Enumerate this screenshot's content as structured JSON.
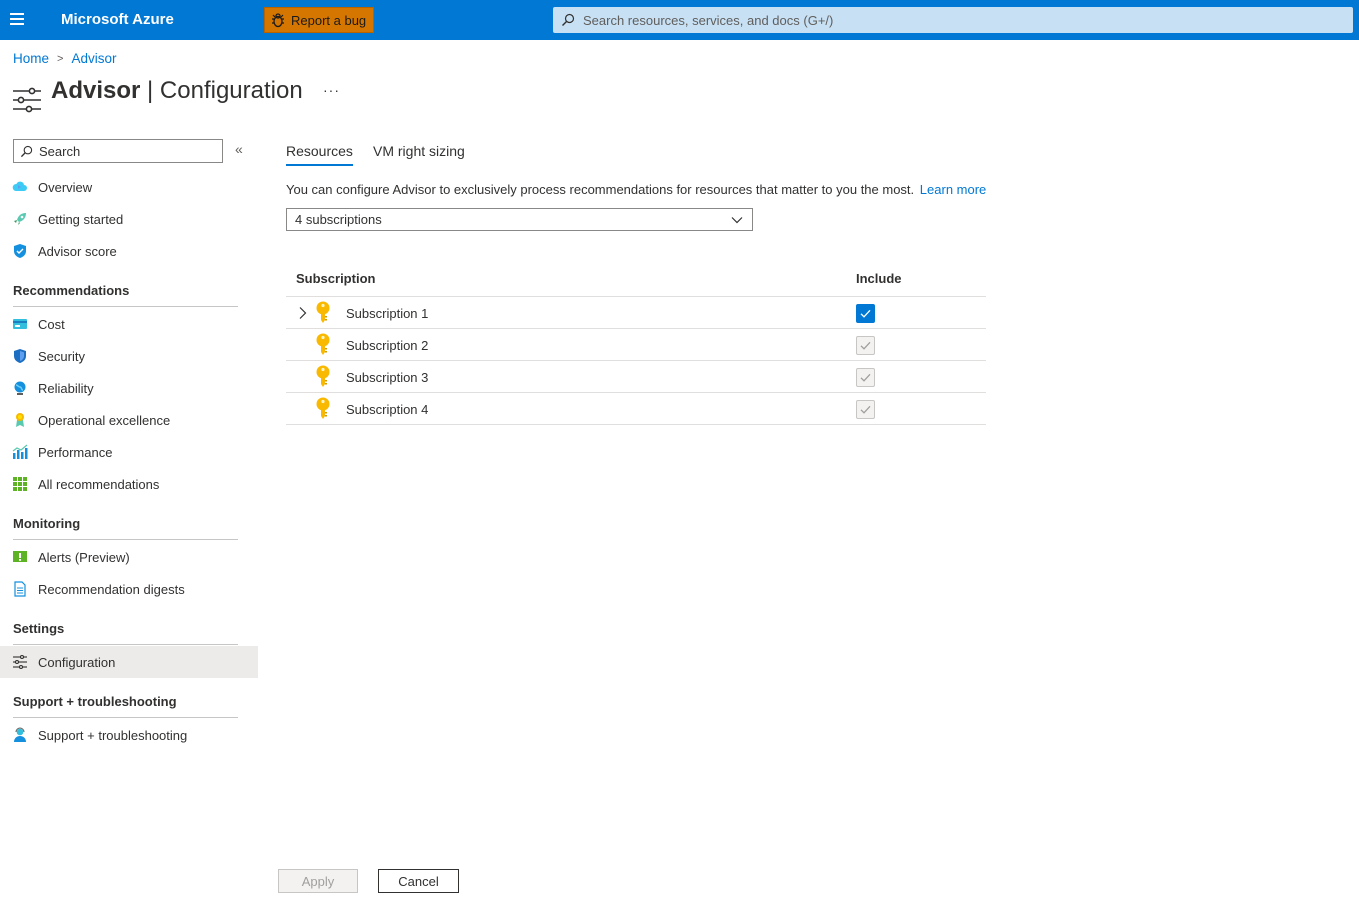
{
  "topbar": {
    "brand": "Microsoft Azure",
    "report_bug_label": "Report a bug",
    "search_placeholder": "Search resources, services, and docs (G+/)"
  },
  "breadcrumb": {
    "home": "Home",
    "advisor": "Advisor",
    "separator": ">"
  },
  "page": {
    "title_bold": "Advisor",
    "title_rest": "| Configuration",
    "more": "···"
  },
  "sidebar": {
    "search_placeholder": "Search",
    "collapse_glyph": "«",
    "top_items": [
      {
        "label": "Overview",
        "icon": "cloud-icon"
      },
      {
        "label": "Getting started",
        "icon": "rocket-icon"
      },
      {
        "label": "Advisor score",
        "icon": "shield-score-icon"
      }
    ],
    "sections": [
      {
        "heading": "Recommendations",
        "items": [
          {
            "label": "Cost",
            "icon": "cost-icon"
          },
          {
            "label": "Security",
            "icon": "security-shield-icon"
          },
          {
            "label": "Reliability",
            "icon": "globe-icon"
          },
          {
            "label": "Operational excellence",
            "icon": "ribbon-icon"
          },
          {
            "label": "Performance",
            "icon": "performance-chart-icon"
          },
          {
            "label": "All recommendations",
            "icon": "grid-icon"
          }
        ]
      },
      {
        "heading": "Monitoring",
        "items": [
          {
            "label": "Alerts (Preview)",
            "icon": "alert-icon"
          },
          {
            "label": "Recommendation digests",
            "icon": "document-icon"
          }
        ]
      },
      {
        "heading": "Settings",
        "items": [
          {
            "label": "Configuration",
            "icon": "sliders-icon"
          }
        ]
      },
      {
        "heading": "Support + troubleshooting",
        "items": [
          {
            "label": "Support + troubleshooting",
            "icon": "support-person-icon"
          }
        ]
      }
    ]
  },
  "main": {
    "tabs": [
      {
        "label": "Resources",
        "active": true
      },
      {
        "label": "VM right sizing",
        "active": false
      }
    ],
    "description": "You can configure Advisor to exclusively process recommendations for resources that matter to you the most.",
    "learn_more": "Learn more",
    "dropdown_value": "4 subscriptions",
    "table": {
      "col_subscription": "Subscription",
      "col_include": "Include",
      "rows": [
        {
          "name": "Subscription 1",
          "expandable": true,
          "include": "checked"
        },
        {
          "name": "Subscription 2",
          "expandable": false,
          "include": "checked-disabled"
        },
        {
          "name": "Subscription 3",
          "expandable": false,
          "include": "checked-disabled"
        },
        {
          "name": "Subscription 4",
          "expandable": false,
          "include": "checked-disabled"
        }
      ]
    }
  },
  "footer": {
    "apply_label": "Apply",
    "cancel_label": "Cancel"
  },
  "colors": {
    "accent": "#0078d4",
    "topbar": "#0078d4",
    "bug_button": "#d57600",
    "key_icon": "#f8b900"
  }
}
